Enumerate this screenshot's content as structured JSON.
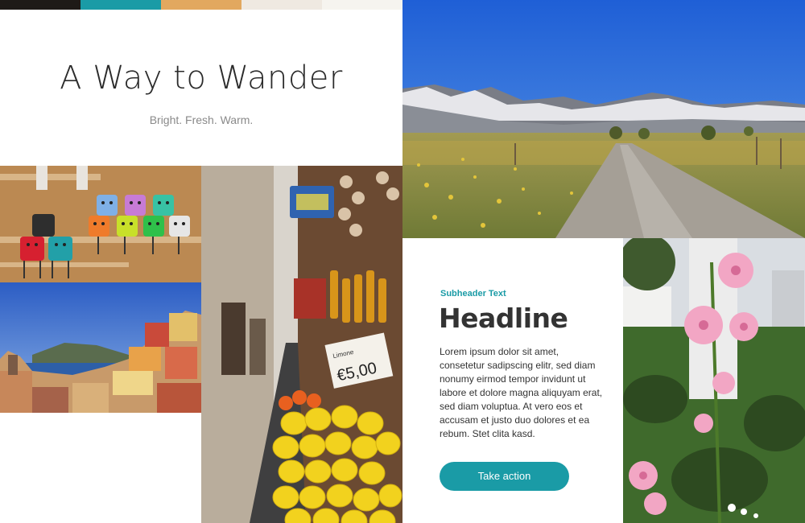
{
  "palette": {
    "colors": [
      "#1e1a17",
      "#1a9ba6",
      "#e2a85f",
      "#efe9e1",
      "#f6f4ef"
    ]
  },
  "header": {
    "title": "A Way to Wander",
    "tagline": "Bright. Fresh. Warm."
  },
  "card": {
    "subheader": "Subheader Text",
    "headline": "Headline",
    "body": "Lorem ipsum dolor sit amet, consetetur sadipscing elitr, sed diam nonumy eirmod tempor invidunt ut labore et dolore magna aliquyam erat, sed diam voluptua. At vero eos et accusam et justo duo dolores et ea rebum. Stet clita kasd.",
    "cta_label": "Take action",
    "accent": "#1a9ba6"
  },
  "photos": {
    "mountain_road": "mountain-road-photo",
    "toy_robots": "toy-robots-photo",
    "coastal_village": "coastal-village-photo",
    "market_alley": "market-alley-photo",
    "hollyhocks": "hollyhock-flowers-photo"
  },
  "market_sign": {
    "price": "€5,00"
  }
}
